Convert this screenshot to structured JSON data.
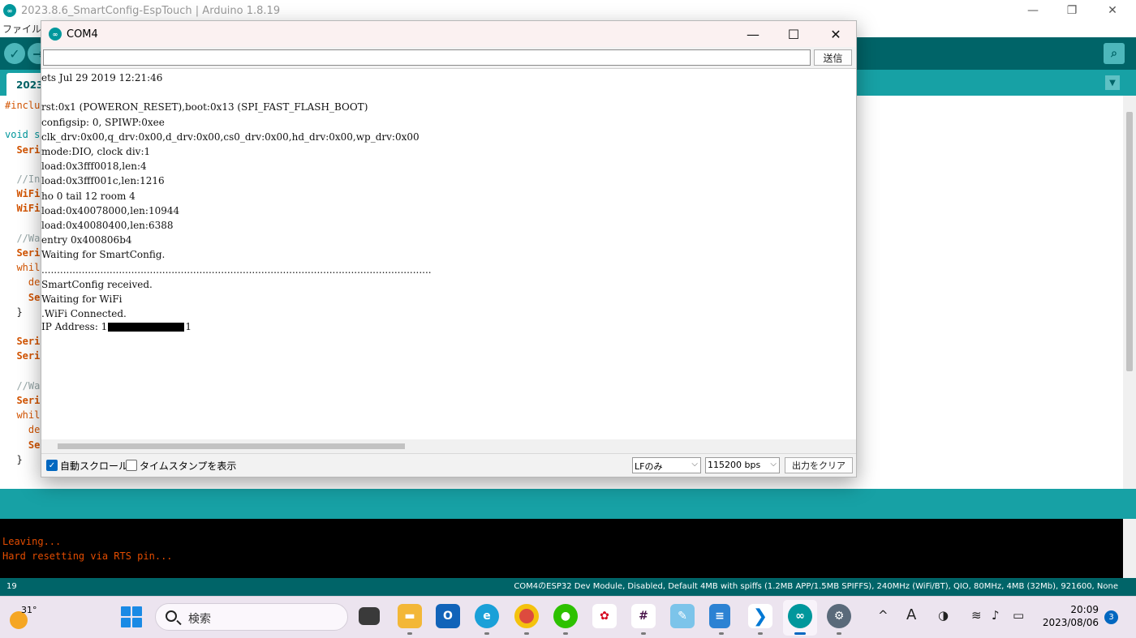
{
  "arduino": {
    "window_title": "2023.8.6_SmartConfig-EspTouch | Arduino 1.8.19",
    "menu_visible": "ファイル 編",
    "tab_label": "2023",
    "code_lines": [
      {
        "text": "#inclu",
        "cls": "kw2"
      },
      {
        "text": "",
        "cls": ""
      },
      {
        "text": "void s",
        "cls": "kw"
      },
      {
        "text": "  Seri",
        "cls": "fn"
      },
      {
        "text": "",
        "cls": ""
      },
      {
        "text": "  //In",
        "cls": "cm"
      },
      {
        "text": "  WiFi",
        "cls": "fn"
      },
      {
        "text": "  WiFi",
        "cls": "fn"
      },
      {
        "text": "",
        "cls": ""
      },
      {
        "text": "  //Wa",
        "cls": "cm"
      },
      {
        "text": "  Seri",
        "cls": "fn"
      },
      {
        "text": "  whil",
        "cls": "kw2"
      },
      {
        "text": "    de",
        "cls": "kw2"
      },
      {
        "text": "    Se",
        "cls": "fn"
      },
      {
        "text": "  }",
        "cls": ""
      },
      {
        "text": "",
        "cls": ""
      },
      {
        "text": "  Seri",
        "cls": "fn"
      },
      {
        "text": "  Seri",
        "cls": "fn"
      },
      {
        "text": "",
        "cls": ""
      },
      {
        "text": "  //Wa",
        "cls": "cm"
      },
      {
        "text": "  Seri",
        "cls": "fn"
      },
      {
        "text": "  whil",
        "cls": "kw2"
      },
      {
        "text": "    de",
        "cls": "kw2"
      },
      {
        "text": "    Se",
        "cls": "fn"
      },
      {
        "text": "  }",
        "cls": ""
      }
    ],
    "console_lines": [
      "Leaving...",
      "Hard resetting via RTS pin..."
    ],
    "status": {
      "line_number": "19",
      "board_info": "COM4のESP32 Dev Module, Disabled, Default 4MB with spiffs (1.2MB APP/1.5MB SPIFFS), 240MHz (WiFi/BT), QIO, 80MHz, 4MB (32Mb), 921600, None"
    }
  },
  "serial_monitor": {
    "title": "COM4",
    "input_value": "",
    "send_label": "送信",
    "output_lines": [
      "ets Jul 29 2019 12:21:46",
      "",
      "rst:0x1 (POWERON_RESET),boot:0x13 (SPI_FAST_FLASH_BOOT)",
      "configsip: 0, SPIWP:0xee",
      "clk_drv:0x00,q_drv:0x00,d_drv:0x00,cs0_drv:0x00,hd_drv:0x00,wp_drv:0x00",
      "mode:DIO, clock div:1",
      "load:0x3fff0018,len:4",
      "load:0x3fff001c,len:1216",
      "ho 0 tail 12 room 4",
      "load:0x40078000,len:10944",
      "load:0x40080400,len:6388",
      "entry 0x400806b4",
      "Waiting for SmartConfig.",
      "..............................................................................................................................",
      "SmartConfig received.",
      "Waiting for WiFi",
      ".WiFi Connected."
    ],
    "ip_label_prefix": "IP Address: 1",
    "ip_label_suffix": "1",
    "autoscroll_label": "自動スクロール",
    "autoscroll_checked": true,
    "timestamp_label": "タイムスタンプを表示",
    "timestamp_checked": false,
    "line_ending": "LFのみ",
    "baud_rate": "115200 bps",
    "clear_label": "出力をクリア"
  },
  "taskbar": {
    "weather_temp": "31°",
    "search_placeholder": "検索",
    "time": "20:09",
    "date": "2023/08/06",
    "notification_count": "3",
    "ime_indicator": "A"
  }
}
